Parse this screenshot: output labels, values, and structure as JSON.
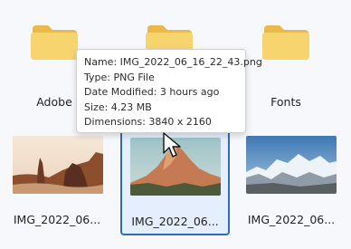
{
  "items": {
    "folder_left": {
      "label": "Adobe"
    },
    "folder_center": {
      "label": ""
    },
    "folder_right": {
      "label": "Fonts"
    },
    "image_1": {
      "label": "IMG_2022_06..."
    },
    "image_2": {
      "label": "IMG_2022_06..."
    },
    "image_3": {
      "label": "IMG_2022_06..."
    }
  },
  "tooltip": {
    "name": "Name: IMG_2022_06_16_22_43.png",
    "type": "Type: PNG File",
    "date_modified": "Date Modified: 3 hours ago",
    "size": "Size: 4.23 MB",
    "dimensions": "Dimensions: 3840 x 2160"
  },
  "colors": {
    "folder_back": "#e9b949",
    "folder_front": "#f7d46d",
    "selection_border": "#2f6db2",
    "tooltip_background": "#ffffff"
  },
  "icons": {
    "folder": "folder-icon",
    "image_1": "desert-rock-thumbnail",
    "image_2": "mountain-thumbnail",
    "image_3": "snow-mountain-thumbnail",
    "cursor": "mouse-pointer-icon"
  }
}
